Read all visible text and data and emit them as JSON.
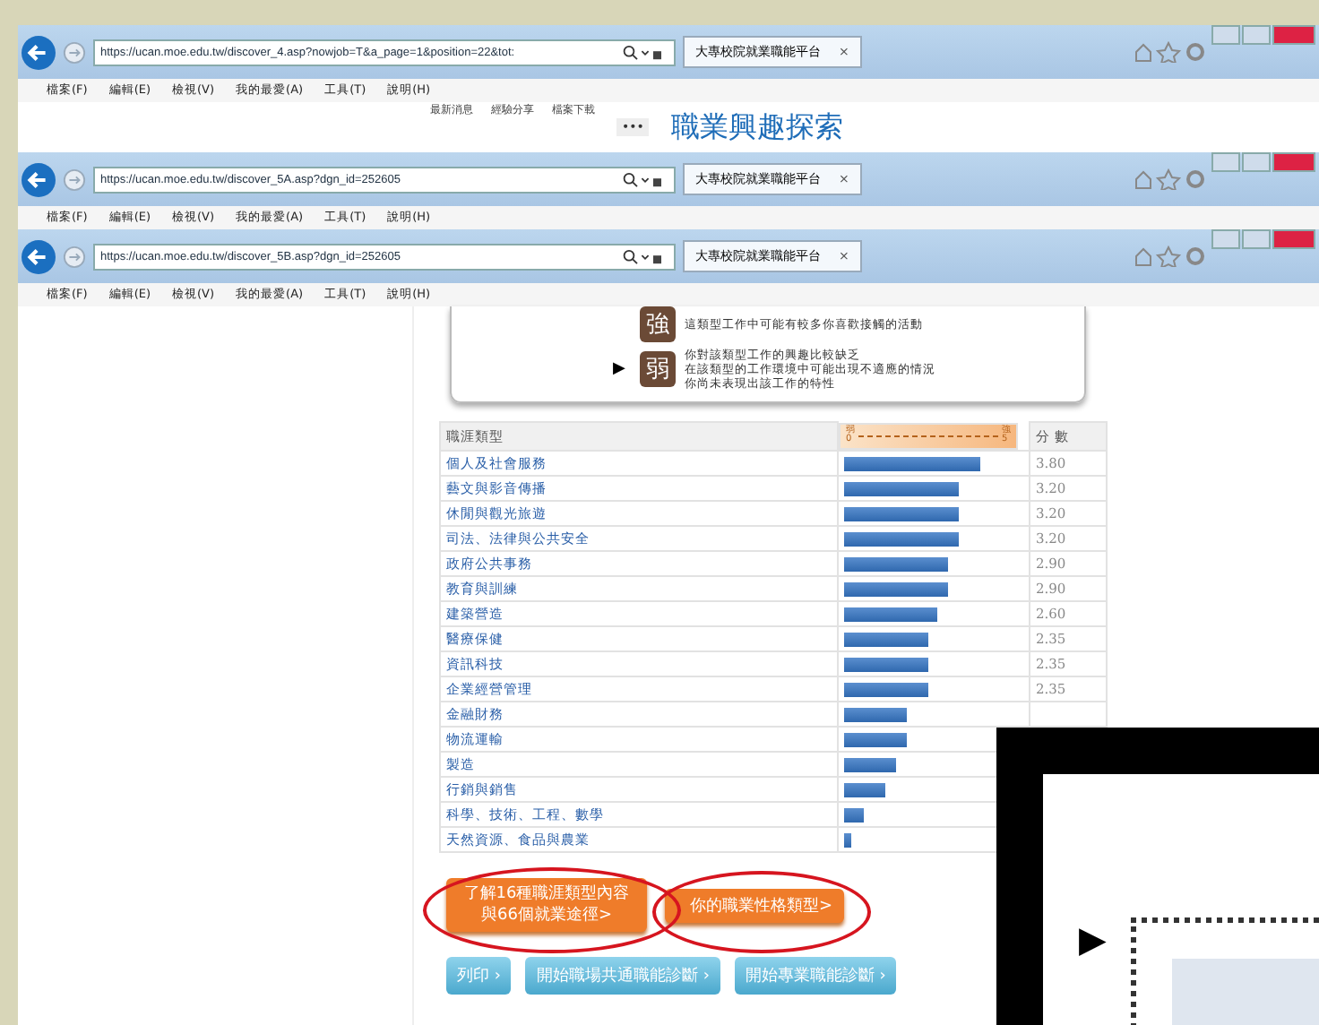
{
  "windows": [
    {
      "url": "https://ucan.moe.edu.tw/discover_4.asp?nowjob=T&a_page=1&position=22&tot:",
      "tab": "大專校院就業職能平台",
      "tab_close": "×",
      "menu": [
        "檔案(F)",
        "編輯(E)",
        "檢視(V)",
        "我的最愛(A)",
        "工具(T)",
        "說明(H)"
      ],
      "page_tabs": [
        "最新消息",
        "經驗分享",
        "檔案下載"
      ],
      "page_menu": "•••",
      "page_heading": "職業興趣探索"
    },
    {
      "url": "https://ucan.moe.edu.tw/discover_5A.asp?dgn_id=252605",
      "tab": "大專校院就業職能平台",
      "tab_close": "×",
      "menu": [
        "檔案(F)",
        "編輯(E)",
        "檢視(V)",
        "我的最愛(A)",
        "工具(T)",
        "說明(H)"
      ]
    },
    {
      "url": "https://ucan.moe.edu.tw/discover_5B.asp?dgn_id=252605",
      "tab": "大專校院就業職能平台",
      "tab_close": "×",
      "menu": [
        "檔案(F)",
        "編輯(E)",
        "檢視(V)",
        "我的最愛(A)",
        "工具(T)",
        "說明(H)"
      ]
    }
  ],
  "legend": [
    {
      "badge": "強",
      "lines": [
        "這類型工作中可能有較多你喜歡接觸的活動"
      ]
    },
    {
      "badge": "弱",
      "lines": [
        "你對該類型工作的興趣比較缺乏",
        "在該類型的工作環境中可能出現不適應的情況",
        "你尚未表現出該工作的特性"
      ],
      "pointer": "▶"
    }
  ],
  "table": {
    "columns": [
      "職涯類型",
      "分 數"
    ],
    "scale_low": "弱",
    "scale_low_value": "0",
    "scale_high": "強",
    "scale_high_value": "5",
    "rows": [
      {
        "name": "個人及社會服務",
        "level": 0.76,
        "score": "3.80"
      },
      {
        "name": "藝文與影音傳播",
        "level": 0.64,
        "score": "3.20"
      },
      {
        "name": "休閒與觀光旅遊",
        "level": 0.64,
        "score": "3.20"
      },
      {
        "name": "司法、法律與公共安全",
        "level": 0.64,
        "score": "3.20"
      },
      {
        "name": "政府公共事務",
        "level": 0.58,
        "score": "2.90"
      },
      {
        "name": "教育與訓練",
        "level": 0.58,
        "score": "2.90"
      },
      {
        "name": "建築營造",
        "level": 0.52,
        "score": "2.60"
      },
      {
        "name": "醫療保健",
        "level": 0.47,
        "score": "2.35"
      },
      {
        "name": "資訊科技",
        "level": 0.47,
        "score": "2.35"
      },
      {
        "name": "企業經營管理",
        "level": 0.47,
        "score": "2.35"
      },
      {
        "name": "金融財務",
        "level": 0.35
      },
      {
        "name": "物流運輸",
        "level": 0.35
      },
      {
        "name": "製造",
        "level": 0.29
      },
      {
        "name": "行銷與銷售",
        "level": 0.23
      },
      {
        "name": "科學、技術、工程、數學",
        "level": 0.11
      },
      {
        "name": "天然資源、食品與農業",
        "level": 0.04
      }
    ]
  },
  "orange_buttons": [
    "了解16種職涯類型內容與66個就業途徑>",
    "你的職業性格類型>"
  ],
  "blue_buttons": [
    {
      "label": "列印",
      "chevron": "›"
    },
    {
      "label": "開始職場共通職能診斷",
      "chevron": "›"
    },
    {
      "label": "開始專業職能診斷",
      "chevron": "›"
    }
  ],
  "overlay": {
    "pointer": "▶"
  }
}
